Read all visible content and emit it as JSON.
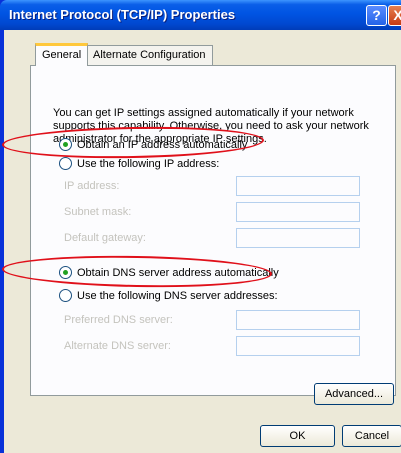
{
  "window": {
    "title": "Internet Protocol (TCP/IP) Properties",
    "help_glyph": "?",
    "close_glyph": "X"
  },
  "tabs": [
    {
      "label": "General",
      "active": true
    },
    {
      "label": "Alternate Configuration",
      "active": false
    }
  ],
  "intro_text": "You can get IP settings assigned automatically if your network supports this capability. Otherwise, you need to ask your network administrator for the appropriate IP settings.",
  "ip": {
    "auto_label": "Obtain an IP address automatically",
    "auto_selected": true,
    "manual_label": "Use the following IP address:",
    "fields": [
      {
        "label": "IP address:",
        "value": ""
      },
      {
        "label": "Subnet mask:",
        "value": ""
      },
      {
        "label": "Default gateway:",
        "value": ""
      }
    ]
  },
  "dns": {
    "auto_label": "Obtain DNS server address automatically",
    "auto_selected": true,
    "manual_label": "Use the following DNS server addresses:",
    "fields": [
      {
        "label": "Preferred DNS server:",
        "value": ""
      },
      {
        "label": "Alternate DNS server:",
        "value": ""
      }
    ]
  },
  "buttons": {
    "advanced": "Advanced...",
    "ok": "OK",
    "cancel": "Cancel"
  },
  "colors": {
    "titlebar": "#0054e3",
    "dialog_background": "#ece9d8",
    "annotation_ring": "#e0101a",
    "disabled_text": "#c4c3bd"
  }
}
